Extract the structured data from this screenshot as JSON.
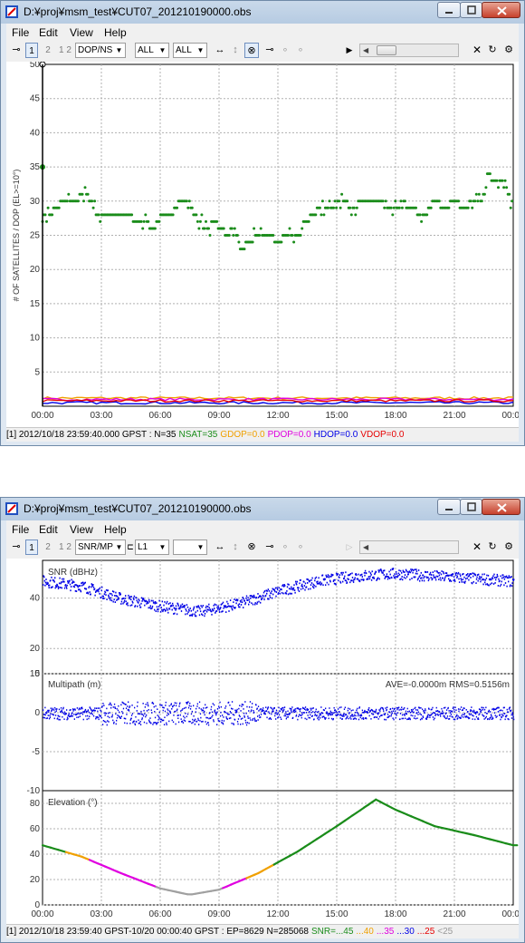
{
  "w1": {
    "title": "D:¥proj¥msm_test¥CUT07_201210190000.obs",
    "menu": [
      "File",
      "Edit",
      "View",
      "Help"
    ],
    "toolbar": {
      "b1": "1",
      "b2": "2",
      "b12": "1 2",
      "combo1": "DOP/NS",
      "combo2": "ALL",
      "combo3": "ALL"
    },
    "ylabel": "# OF SATELLITES / DOP (EL>=10°)",
    "status": {
      "prefix": "[1] 2012/10/18 23:59:40.000 GPST : N=35",
      "nsat": "NSAT=35",
      "gdop": "GDOP=0.0",
      "pdop": "PDOP=0.0",
      "hdop": "HDOP=0.0",
      "vdop": "VDOP=0.0"
    }
  },
  "w2": {
    "title": "D:¥proj¥msm_test¥CUT07_201210190000.obs",
    "menu": [
      "File",
      "Edit",
      "View",
      "Help"
    ],
    "toolbar": {
      "b1": "1",
      "b2": "2",
      "b12": "1 2",
      "combo1": "SNR/MP",
      "combo2": "L1",
      "combo3": ""
    },
    "panels": {
      "snr": "SNR (dBHz)",
      "mp": "Multipath (m)",
      "mp_stats": "AVE=-0.0000m RMS=0.5156m",
      "el": "Elevation (°)"
    },
    "status": {
      "prefix": "[1] 2012/10/18 23:59:40 GPST-10/20 00:00:40 GPST : EP=8629 N=285068",
      "snr": "SNR=...45",
      "s40": "...40",
      "s35": "...35",
      "s30": "...30",
      "s25": "...25",
      "slt25": "<25"
    }
  },
  "colors": {
    "green": "#1a8c1a",
    "orange": "#f0a000",
    "magenta": "#e000e0",
    "blue": "#0000e6",
    "red": "#e60000",
    "gray": "#a0a0a0"
  },
  "chart_data": [
    {
      "type": "scatter",
      "xlabel": "",
      "ylabel": "# OF SATELLITES / DOP (EL>=10°)",
      "ylim": [
        0,
        50
      ],
      "xticks": [
        "00:00",
        "03:00",
        "06:00",
        "09:00",
        "12:00",
        "15:00",
        "18:00",
        "21:00",
        "00:00"
      ],
      "yticks": [
        "5",
        "10",
        "15",
        "20",
        "25",
        "30",
        "35",
        "40",
        "45",
        "50"
      ],
      "grid": true,
      "series": [
        {
          "name": "NSAT",
          "color": "green",
          "x_hours": [
            0,
            0.3,
            0.7,
            1.1,
            1.5,
            2.0,
            2.5,
            2.8,
            3.2,
            3.8,
            4.3,
            4.8,
            5.2,
            5.7,
            6.1,
            6.6,
            7.0,
            7.4,
            7.8,
            8.3,
            8.8,
            9.3,
            9.8,
            10.1,
            10.5,
            11.0,
            11.5,
            12.0,
            12.5,
            13.0,
            13.4,
            13.8,
            14.2,
            14.8,
            15.3,
            15.8,
            16.3,
            16.8,
            17.3,
            17.8,
            18.4,
            19.0,
            19.5,
            20.0,
            20.5,
            21.0,
            21.5,
            22.0,
            22.4,
            22.8,
            23.2,
            23.6,
            24.0
          ],
          "values": [
            28,
            28,
            29,
            30,
            30,
            31,
            30,
            28,
            28,
            28,
            28,
            27,
            27,
            26,
            28,
            28,
            30,
            30,
            28,
            26,
            27,
            25,
            26,
            23,
            24,
            25,
            25,
            24,
            25,
            25,
            27,
            28,
            29,
            29,
            30,
            29,
            30,
            30,
            30,
            29,
            29,
            29,
            28,
            30,
            29,
            30,
            29,
            30,
            30,
            34,
            33,
            33,
            29
          ]
        },
        {
          "name": "GDOP",
          "color": "orange",
          "values": [
            1.2
          ]
        },
        {
          "name": "PDOP",
          "color": "magenta",
          "values": [
            1.0
          ]
        },
        {
          "name": "HDOP",
          "color": "blue",
          "values": [
            0.5
          ]
        },
        {
          "name": "VDOP",
          "color": "red",
          "values": [
            0.8
          ]
        }
      ]
    },
    {
      "type": "scatter",
      "title": "SNR (dBHz)",
      "ylim": [
        10,
        55
      ],
      "yticks": [
        "10",
        "20",
        "40"
      ],
      "series": [
        {
          "color": "blue",
          "x_hours": [
            0,
            2,
            4,
            6,
            8,
            10,
            12,
            14,
            16,
            18,
            20,
            22,
            24
          ],
          "values": [
            47,
            45,
            40,
            37,
            35,
            38,
            43,
            47,
            49,
            50,
            49,
            48,
            47
          ]
        }
      ]
    },
    {
      "type": "scatter",
      "title": "Multipath (m)",
      "ylim": [
        -10,
        5
      ],
      "yticks": [
        "-10",
        "-5",
        "0",
        "5"
      ],
      "series": [
        {
          "color": "blue",
          "x_hours": [
            0,
            24
          ],
          "values": [
            0,
            0
          ]
        }
      ]
    },
    {
      "type": "line",
      "title": "Elevation (°)",
      "ylim": [
        0,
        90
      ],
      "yticks": [
        "0",
        "20",
        "40",
        "60",
        "80"
      ],
      "xticks": [
        "00:00",
        "03:00",
        "06:00",
        "09:00",
        "12:00",
        "15:00",
        "18:00",
        "21:00",
        "00:00"
      ],
      "series": [
        {
          "color": "green",
          "x_hours": [
            0,
            2,
            4,
            6,
            7.5,
            9,
            11,
            13,
            15,
            17,
            18,
            20,
            22,
            24
          ],
          "values": [
            47,
            38,
            25,
            13,
            8,
            12,
            25,
            42,
            62,
            83,
            75,
            62,
            55,
            47
          ]
        }
      ]
    }
  ]
}
